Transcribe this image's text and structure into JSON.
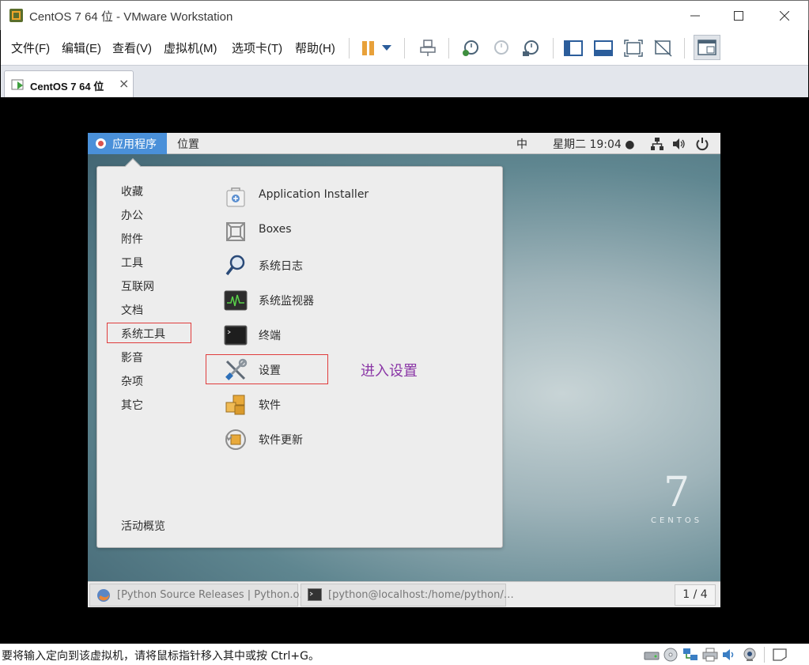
{
  "window": {
    "title": "CentOS 7 64 位 - VMware Workstation",
    "controls": [
      "minimize",
      "maximize",
      "close"
    ]
  },
  "menubar": {
    "items": [
      "文件(F)",
      "编辑(E)",
      "查看(V)",
      "虚拟机(M)",
      "选项卡(T)",
      "帮助(H)"
    ]
  },
  "toolbar": {
    "icons": [
      "pause-icon",
      "dropdown-icon",
      "send-ctrl-alt-del-icon",
      "snapshot-take-icon",
      "snapshot-revert-icon",
      "snapshot-manager-icon",
      "console-view-icon",
      "quick-switch-icon",
      "fullscreen-icon",
      "unity-icon",
      "library-icon"
    ]
  },
  "tab": {
    "label": "CentOS 7 64 位",
    "close": "×"
  },
  "guest": {
    "topbar": {
      "apps_label": "应用程序",
      "places_label": "位置",
      "ime": "中",
      "clock": "星期二 19:04 ●"
    },
    "categories": [
      "收藏",
      "办公",
      "附件",
      "工具",
      "互联网",
      "文档",
      "系统工具",
      "影音",
      "杂项",
      "其它"
    ],
    "selected_category": "系统工具",
    "activities_label": "活动概览",
    "apps": [
      {
        "label": "Application Installer",
        "icon": "software-bag-icon"
      },
      {
        "label": "Boxes",
        "icon": "boxes-icon"
      },
      {
        "label": "系统日志",
        "icon": "magnifier-log-icon"
      },
      {
        "label": "系统监视器",
        "icon": "system-monitor-icon"
      },
      {
        "label": "终端",
        "icon": "terminal-icon"
      },
      {
        "label": "设置",
        "icon": "settings-tools-icon"
      },
      {
        "label": "软件",
        "icon": "software-boxes-icon"
      },
      {
        "label": "软件更新",
        "icon": "software-update-icon"
      }
    ],
    "annotation": "进入设置",
    "branding": {
      "version": "7",
      "name": "CENTOS"
    },
    "taskbar": {
      "items": [
        "[Python Source Releases | Python.o…",
        "[python@localhost:/home/python/…"
      ],
      "workspace": "1 / 4"
    }
  },
  "statusbar": {
    "text": "要将输入定向到该虚拟机，请将鼠标指针移入其中或按 Ctrl+G。",
    "icons": [
      "hdd-icon",
      "cd-icon",
      "network-icon",
      "printer-icon",
      "sound-icon",
      "webcam-icon",
      "message-icon"
    ]
  }
}
